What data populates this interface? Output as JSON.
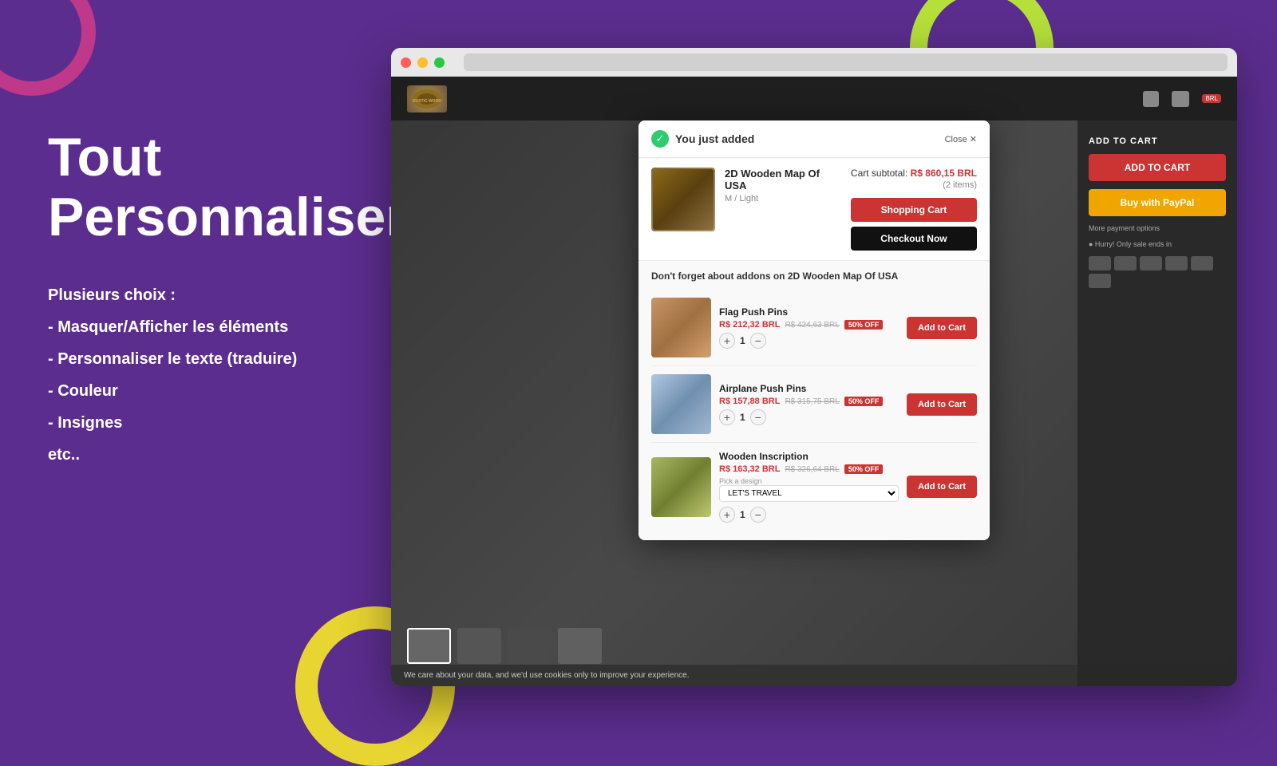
{
  "page": {
    "background_color": "#5b2d8e"
  },
  "left_panel": {
    "title_line1": "Tout",
    "title_line2": "Personnaliser",
    "features_intro": "Plusieurs choix :",
    "feature1": "- Masquer/Afficher les éléments",
    "feature2": "- Personnaliser le texte (traduire)",
    "feature3": "- Couleur",
    "feature4": "- Insignes",
    "feature5": "etc.."
  },
  "browser": {
    "dots": [
      "red",
      "yellow",
      "green"
    ]
  },
  "shop": {
    "logo_text": "RUSTIC WOOD"
  },
  "popup": {
    "close_label": "Close ✕",
    "added_text": "You just added",
    "product_name": "2D Wooden Map Of USA",
    "product_variant": "M / Light",
    "subtotal_label": "Cart subtotal:",
    "subtotal_price": "R$ 860,15 BRL",
    "items_count": "(2 items)",
    "shopping_cart_btn": "Shopping Cart",
    "checkout_btn": "Checkout Now",
    "addons_title": "Don't forget about addons on 2D Wooden Map Of USA",
    "addons": [
      {
        "name": "Flag Push Pins",
        "price_new": "R$ 212,32 BRL",
        "price_old": "R$ 424,63 BRL",
        "badge": "50% OFF",
        "qty": 1,
        "btn_label": "Add to Cart"
      },
      {
        "name": "Airplane Push Pins",
        "price_new": "R$ 157,88 BRL",
        "price_old": "R$ 315,75 BRL",
        "badge": "50% OFF",
        "qty": 1,
        "btn_label": "Add to Cart"
      },
      {
        "name": "Wooden Inscription",
        "price_new": "R$ 163,32 BRL",
        "price_old": "R$ 326,64 BRL",
        "badge": "50% OFF",
        "qty": 1,
        "select_label": "Pick a design",
        "select_value": "LET'S TRAVEL",
        "btn_label": "Add to Cart"
      }
    ]
  },
  "add_to_cart_panel": {
    "label": "ADD TO CART",
    "button_label": "ADD TO CART",
    "paynow_label": "Buy with PayPal",
    "more_payment_label": "More payment options",
    "more_payment_sub": "● Hurry! Only sale ends in"
  },
  "cookie_bar": {
    "text": "We care about your data, and we'd use cookies only to improve your experience."
  }
}
